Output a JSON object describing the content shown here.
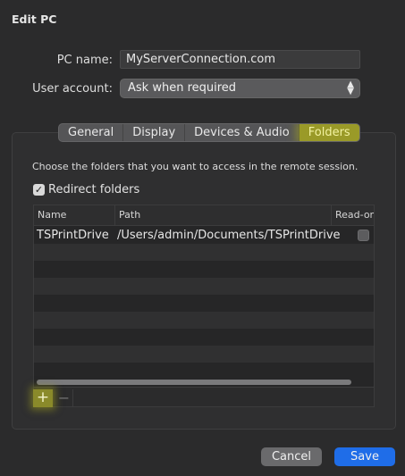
{
  "dialog": {
    "title": "Edit PC"
  },
  "form": {
    "pc_name_label": "PC name:",
    "pc_name_value": "MyServerConnection.com",
    "user_account_label": "User account:",
    "user_account_value": "Ask when required"
  },
  "tabs": [
    {
      "label": "General",
      "selected": false
    },
    {
      "label": "Display",
      "selected": false
    },
    {
      "label": "Devices & Audio",
      "selected": false
    },
    {
      "label": "Folders",
      "selected": true
    }
  ],
  "folders": {
    "description": "Choose the folders that you want to access in the remote session.",
    "redirect_label": "Redirect folders",
    "redirect_checked": true,
    "columns": {
      "name": "Name",
      "path": "Path",
      "readonly": "Read-on"
    },
    "rows": [
      {
        "name": "TSPrintDrive",
        "path": "/Users/admin/Documents/TSPrintDrive",
        "readonly": false
      }
    ],
    "add_label": "+",
    "remove_label": "−"
  },
  "buttons": {
    "cancel": "Cancel",
    "save": "Save"
  },
  "colors": {
    "accent_blue": "#1f6de8",
    "highlight_yellow": "#9a9a28"
  }
}
